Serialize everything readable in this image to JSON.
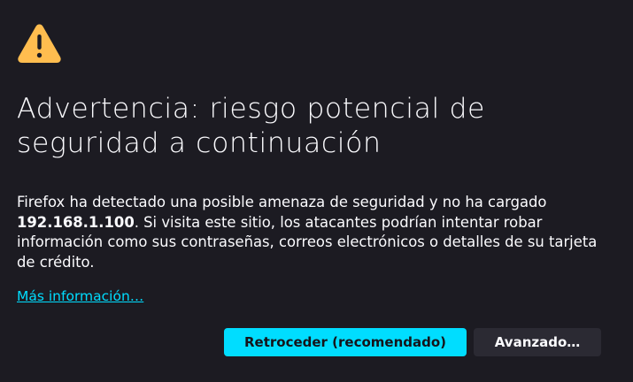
{
  "warning": {
    "icon": "warning-triangle-icon",
    "icon_color": "#ffbd4f"
  },
  "title": "Advertencia: riesgo potencial de seguridad a continuación",
  "description": {
    "part1": "Firefox ha detectado una posible amenaza de seguridad y no ha cargado ",
    "host": "192.168.1.100",
    "part2": ". Si visita este sitio, los atacantes podrían intentar robar información como sus contraseñas, correos electrónicos o detalles de su tarjeta de crédito."
  },
  "learn_more_label": "Más información…",
  "buttons": {
    "go_back_label": "Retroceder (recomendado)",
    "advanced_label": "Avanzado…"
  },
  "colors": {
    "background": "#1c1b22",
    "accent": "#00ddff",
    "secondary_button": "#2b2a33"
  }
}
